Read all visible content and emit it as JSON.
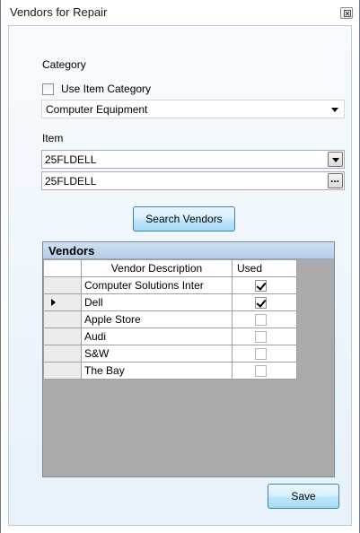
{
  "window": {
    "title": "Vendors for Repair"
  },
  "category": {
    "label": "Category",
    "use_item_category_label": "Use Item Category",
    "use_item_category_checked": false,
    "selected": "Computer Equipment"
  },
  "item": {
    "label": "Item",
    "selected": "25FLDELL",
    "text_value": "25FLDELL",
    "browse_label": "..."
  },
  "search_button": {
    "label": "Search Vendors"
  },
  "vendors_grid": {
    "caption": "Vendors",
    "columns": [
      "Vendor Description",
      "Used"
    ],
    "current_row": 1,
    "rows": [
      {
        "description": "Computer Solutions Inter",
        "used": true
      },
      {
        "description": "Dell",
        "used": true
      },
      {
        "description": "Apple Store",
        "used": false
      },
      {
        "description": "Audi",
        "used": false
      },
      {
        "description": "S&W",
        "used": false
      },
      {
        "description": "The Bay",
        "used": false
      }
    ]
  },
  "save_button": {
    "label": "Save"
  }
}
